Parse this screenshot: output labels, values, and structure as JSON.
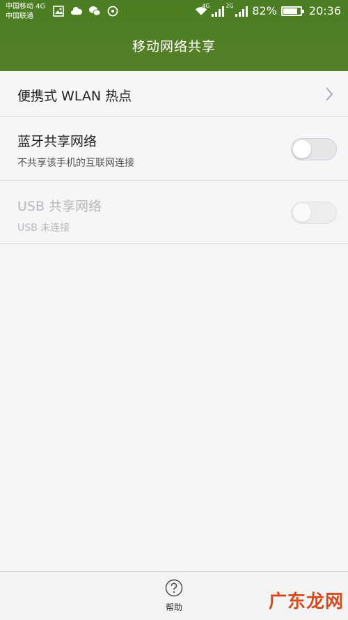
{
  "status_bar": {
    "carrier_1": "中国移动 4G",
    "carrier_2": "中国联通",
    "sig1_tag": "4G",
    "sig2_tag": "2G",
    "battery": "82%",
    "time": "20:36"
  },
  "header": {
    "title": "移动网络共享"
  },
  "rows": [
    {
      "label": "便携式 WLAN 热点"
    },
    {
      "label": "蓝牙共享网络",
      "sub": "不共享该手机的互联网连接",
      "enabled": true,
      "on": false
    },
    {
      "label": "USB 共享网络",
      "sub": "USB 未连接",
      "enabled": false,
      "on": false
    }
  ],
  "bottom": {
    "help_label": "帮助"
  },
  "watermark": {
    "text": "广东龙网"
  },
  "colors": {
    "header": "#527f26",
    "background": "#f6f5f7"
  }
}
